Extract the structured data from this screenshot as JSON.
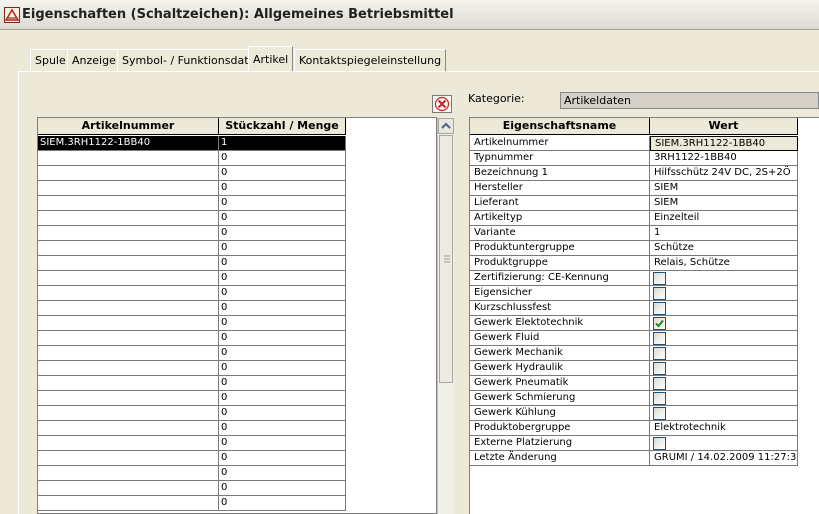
{
  "window": {
    "title": "Eigenschaften (Schaltzeichen): Allgemeines Betriebsmittel"
  },
  "tabs": [
    {
      "label": "Spule"
    },
    {
      "label": "Anzeige"
    },
    {
      "label": "Symbol- / Funktionsdaten"
    },
    {
      "label": "Artikel"
    },
    {
      "label": "Kontaktspiegeleinstellung"
    }
  ],
  "active_tab": "Artikel",
  "left_grid": {
    "headers": {
      "article": "Artikelnummer",
      "qty": "Stückzahl / Menge"
    },
    "rows": [
      {
        "article": "SIEM.3RH1122-1BB40",
        "qty": "1"
      },
      {
        "article": "",
        "qty": "0"
      },
      {
        "article": "",
        "qty": "0"
      },
      {
        "article": "",
        "qty": "0"
      },
      {
        "article": "",
        "qty": "0"
      },
      {
        "article": "",
        "qty": "0"
      },
      {
        "article": "",
        "qty": "0"
      },
      {
        "article": "",
        "qty": "0"
      },
      {
        "article": "",
        "qty": "0"
      },
      {
        "article": "",
        "qty": "0"
      },
      {
        "article": "",
        "qty": "0"
      },
      {
        "article": "",
        "qty": "0"
      },
      {
        "article": "",
        "qty": "0"
      },
      {
        "article": "",
        "qty": "0"
      },
      {
        "article": "",
        "qty": "0"
      },
      {
        "article": "",
        "qty": "0"
      },
      {
        "article": "",
        "qty": "0"
      },
      {
        "article": "",
        "qty": "0"
      },
      {
        "article": "",
        "qty": "0"
      },
      {
        "article": "",
        "qty": "0"
      },
      {
        "article": "",
        "qty": "0"
      },
      {
        "article": "",
        "qty": "0"
      },
      {
        "article": "",
        "qty": "0"
      },
      {
        "article": "",
        "qty": "0"
      },
      {
        "article": "",
        "qty": "0"
      }
    ]
  },
  "category": {
    "label": "Kategorie:",
    "value": "Artikeldaten"
  },
  "right_grid": {
    "headers": {
      "name": "Eigenschaftsname",
      "value": "Wert"
    },
    "rows": [
      {
        "name": "Artikelnummer",
        "value": "SIEM.3RH1122-1BB40",
        "type": "text"
      },
      {
        "name": "Typnummer",
        "value": "3RH1122-1BB40",
        "type": "text"
      },
      {
        "name": "Bezeichnung 1",
        "value": "Hilfsschütz 24V DC, 2S+2Ö",
        "type": "text"
      },
      {
        "name": "Hersteller",
        "value": "SIEM",
        "type": "text"
      },
      {
        "name": "Lieferant",
        "value": "SIEM",
        "type": "text"
      },
      {
        "name": "Artikeltyp",
        "value": "Einzelteil",
        "type": "text"
      },
      {
        "name": "Variante",
        "value": "1",
        "type": "text"
      },
      {
        "name": "Produktuntergruppe",
        "value": "Schütze",
        "type": "text"
      },
      {
        "name": "Produktgruppe",
        "value": "Relais, Schütze",
        "type": "text"
      },
      {
        "name": "Zertifizierung: CE-Kennung",
        "checked": false,
        "type": "check"
      },
      {
        "name": "Eigensicher",
        "checked": false,
        "type": "check"
      },
      {
        "name": "Kurzschlussfest",
        "checked": false,
        "type": "check"
      },
      {
        "name": "Gewerk Elektotechnik",
        "checked": true,
        "type": "check"
      },
      {
        "name": "Gewerk Fluid",
        "checked": false,
        "type": "check"
      },
      {
        "name": "Gewerk Mechanik",
        "checked": false,
        "type": "check"
      },
      {
        "name": "Gewerk Hydraulik",
        "checked": false,
        "type": "check"
      },
      {
        "name": "Gewerk Pneumatik",
        "checked": false,
        "type": "check"
      },
      {
        "name": "Gewerk Schmierung",
        "checked": false,
        "type": "check"
      },
      {
        "name": "Gewerk Kühlung",
        "checked": false,
        "type": "check"
      },
      {
        "name": "Produktobergruppe",
        "value": "Elektrotechnik",
        "type": "text"
      },
      {
        "name": "Externe Platzierung",
        "checked": false,
        "type": "check"
      },
      {
        "name": "Letzte Änderung",
        "value": "GRUMI / 14.02.2009 11:27:3",
        "type": "text"
      }
    ]
  },
  "icons": {
    "app": "app-icon",
    "delete": "close-icon",
    "scroll_up": "chevron-up-icon",
    "scroll_grip": "grip-icon"
  },
  "colors": {
    "selection": "#000000",
    "check": "#1c8c1c",
    "delete_red": "#cc1f1f"
  }
}
